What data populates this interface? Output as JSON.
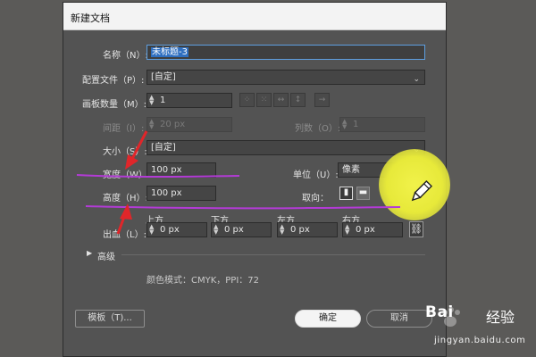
{
  "dialog": {
    "title": "新建文档",
    "name_label": "名称（N）:",
    "name_value": "未标题-3",
    "profile_label": "配置文件（P）:",
    "profile_value": "[自定]",
    "artboards_label": "画板数量（M）:",
    "artboards_value": "1",
    "spacing_label": "间距（I）:",
    "spacing_value": "20 px",
    "columns_label": "列数（O）:",
    "columns_value": "1",
    "size_label": "大小（S）:",
    "size_value": "[自定]",
    "width_label": "宽度（W）:",
    "width_value": "100 px",
    "units_label": "单位（U）:",
    "units_value": "像素",
    "height_label": "高度（H）:",
    "height_value": "100 px",
    "orientation_label": "取向：",
    "bleed": {
      "label": "出血（L）:",
      "top_label": "上方",
      "bottom_label": "下方",
      "left_label": "左方",
      "right_label": "右方",
      "top_value": "0 px",
      "bottom_value": "0 px",
      "left_value": "0 px",
      "right_value": "0 px"
    },
    "advanced_label": "高级",
    "color_mode": "颜色模式：CMYK，PPI：72",
    "template_button": "模板（T)...",
    "ok_button": "确定",
    "cancel_button": "取消"
  },
  "watermark": {
    "brand": "Bai",
    "brand_suffix": "经验",
    "url": "jingyan.baidu.com"
  },
  "colors": {
    "accent_focus": "#5e9fe0",
    "annotation_red": "#e0262a",
    "annotation_magenta": "#b33bd6",
    "highlight_yellow": "#ecee3c"
  },
  "icons": [
    "spinner-icon",
    "grid-by-row-icon",
    "grid-by-column-icon",
    "arrange-by-row-icon",
    "arrange-by-column-icon",
    "right-to-left-icon",
    "portrait-icon",
    "landscape-icon",
    "link-icon",
    "chevron-right-icon",
    "pencil-cursor-icon"
  ]
}
